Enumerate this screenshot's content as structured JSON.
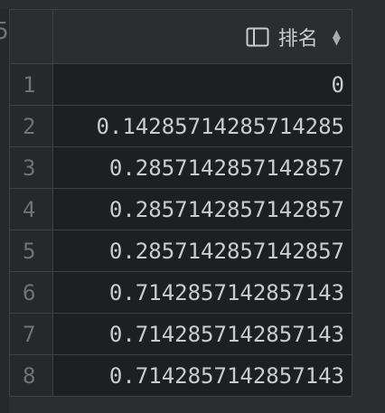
{
  "partial_left_char": "5",
  "column": {
    "title": "排名",
    "icon": "column-icon",
    "sort_icon": "sort-updown-icon"
  },
  "rows": [
    {
      "num": "1",
      "value": "0"
    },
    {
      "num": "2",
      "value": "0.14285714285714285"
    },
    {
      "num": "3",
      "value": "0.2857142857142857"
    },
    {
      "num": "4",
      "value": "0.2857142857142857"
    },
    {
      "num": "5",
      "value": "0.2857142857142857"
    },
    {
      "num": "6",
      "value": "0.7142857142857143"
    },
    {
      "num": "7",
      "value": "0.7142857142857143"
    },
    {
      "num": "8",
      "value": "0.7142857142857143"
    }
  ]
}
